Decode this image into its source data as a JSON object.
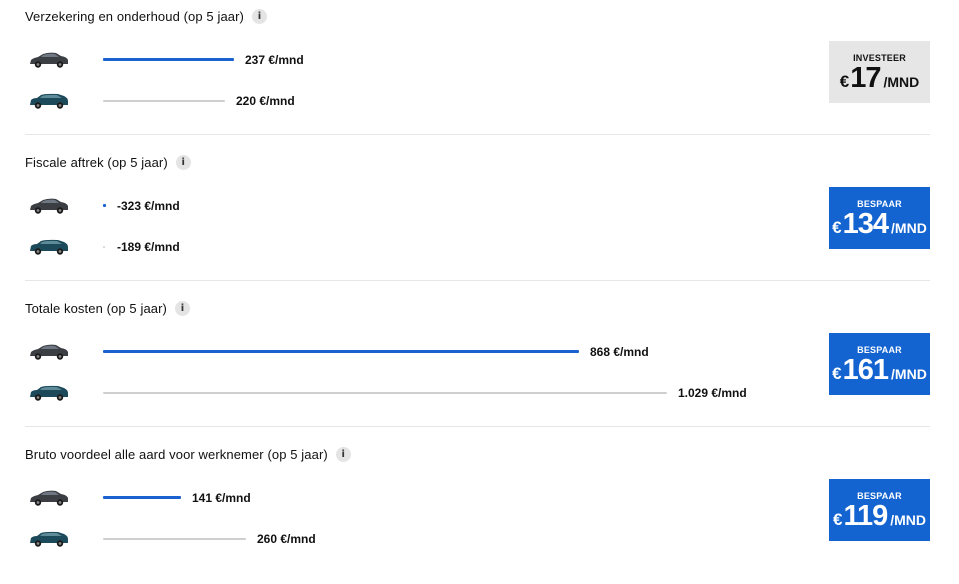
{
  "sections": [
    {
      "title": "Verzekering en onderhoud (op 5 jaar)",
      "rows": [
        {
          "car": "dark-sedan",
          "value": "237 €/mnd",
          "bar_color": "#1b62d1"
        },
        {
          "car": "teal-estate",
          "value": "220 €/mnd",
          "bar_color": "#cfcfcf"
        }
      ],
      "badge": {
        "label": "INVESTEER",
        "currency": "€",
        "amount": "17",
        "unit": "/MND",
        "color": "#e6e6e6"
      }
    },
    {
      "title": "Fiscale aftrek (op 5 jaar)",
      "rows": [
        {
          "car": "dark-sedan",
          "value": "-323 €/mnd",
          "bar_color": "#1b62d1"
        },
        {
          "car": "teal-estate",
          "value": "-189 €/mnd",
          "bar_color": "#cfcfcf"
        }
      ],
      "badge": {
        "label": "BESPAAR",
        "currency": "€",
        "amount": "134",
        "unit": "/MND",
        "color": "#1364d0"
      }
    },
    {
      "title": "Totale kosten (op 5 jaar)",
      "rows": [
        {
          "car": "dark-sedan",
          "value": "868 €/mnd",
          "bar_color": "#1b62d1"
        },
        {
          "car": "teal-estate",
          "value": "1.029 €/mnd",
          "bar_color": "#cfcfcf"
        }
      ],
      "badge": {
        "label": "BESPAAR",
        "currency": "€",
        "amount": "161",
        "unit": "/MND",
        "color": "#1364d0"
      }
    },
    {
      "title": "Bruto voordeel alle aard voor werknemer (op 5 jaar)",
      "rows": [
        {
          "car": "dark-sedan",
          "value": "141 €/mnd",
          "bar_color": "#1b62d1"
        },
        {
          "car": "teal-estate",
          "value": "260 €/mnd",
          "bar_color": "#cfcfcf"
        }
      ],
      "badge": {
        "label": "BESPAAR",
        "currency": "€",
        "amount": "119",
        "unit": "/MND",
        "color": "#1364d0"
      }
    }
  ],
  "info_icon": "i"
}
